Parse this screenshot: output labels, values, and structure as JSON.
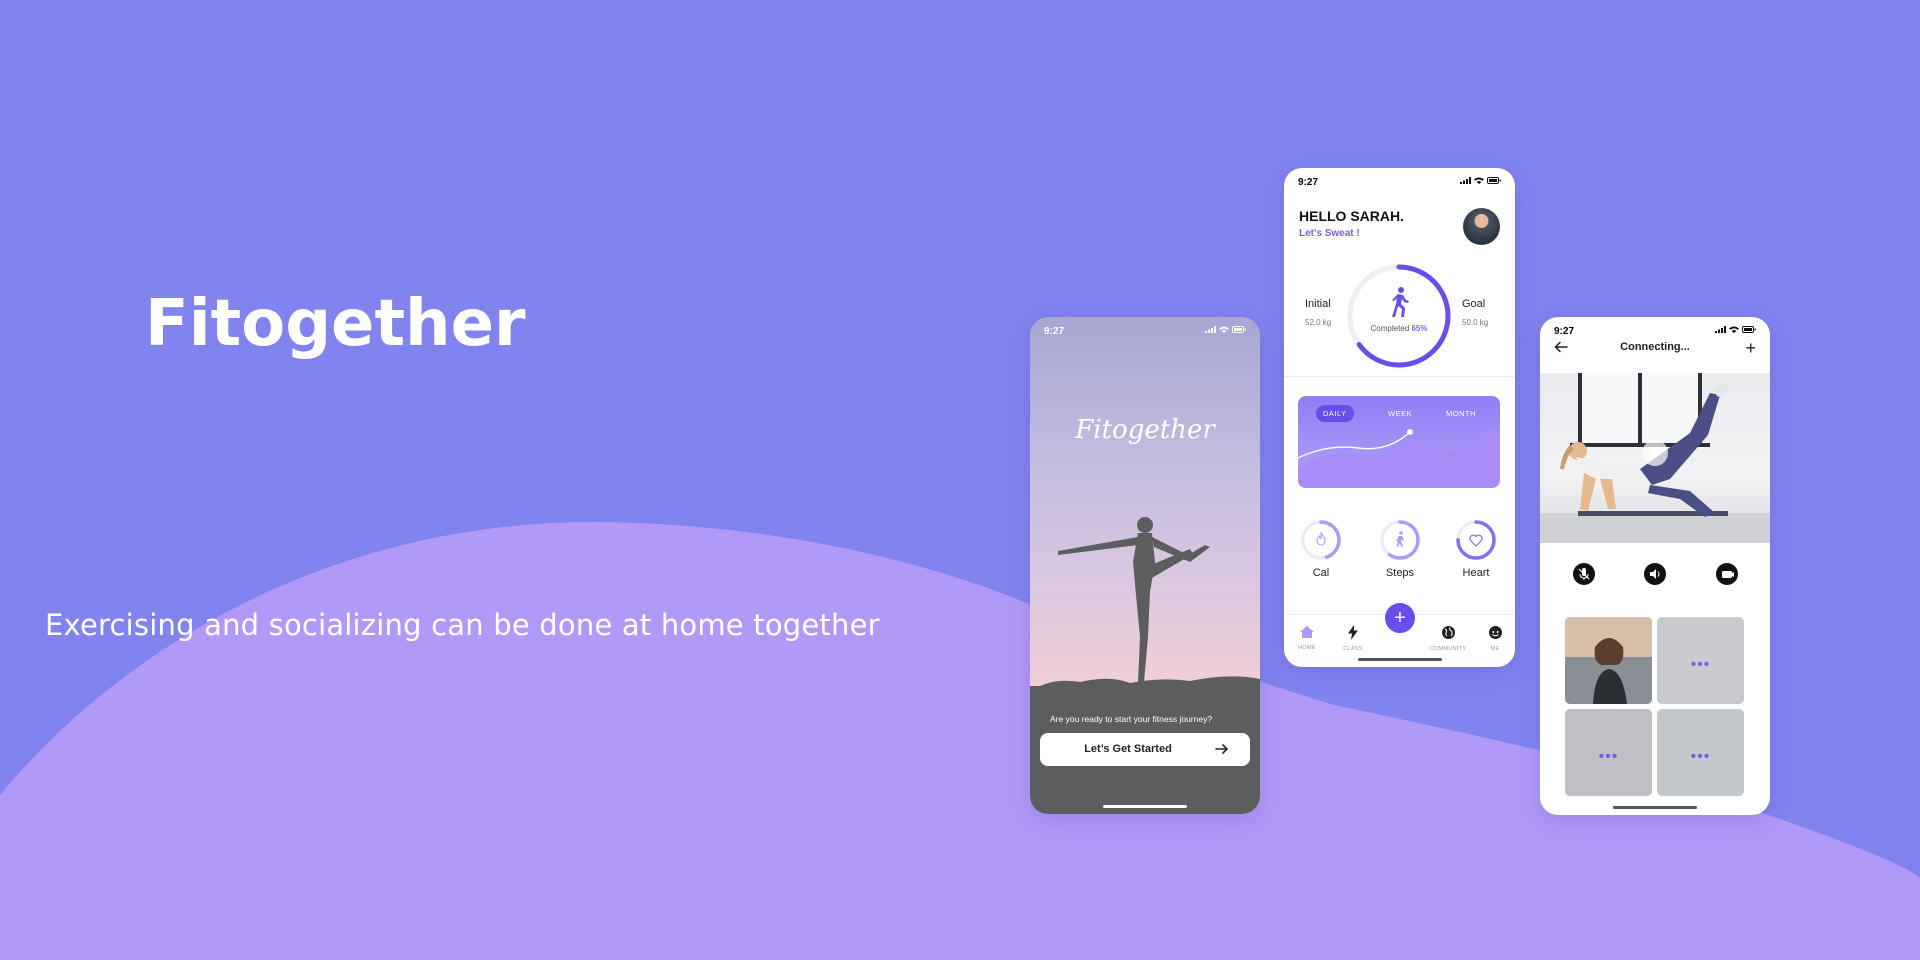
{
  "hero": {
    "title": "Fitogether",
    "subtitle": "Exercising and socializing can be done at home together"
  },
  "colors": {
    "background": "#8183ef",
    "wave": "#b199f7",
    "accent": "#6a4de8",
    "accent_light": "#7b5cf0"
  },
  "phone1": {
    "time": "9:27",
    "logo": "Fitogether",
    "question": "Are you ready to start your fitness journey?",
    "cta_label": "Let’s Get Started"
  },
  "phone2": {
    "time": "9:27",
    "greeting": "HELLO SARAH.",
    "tagline": "Let's Sweat !",
    "initial_label": "Initial",
    "initial_value": "52.0 kg",
    "goal_label": "Goal",
    "goal_value": "50.0 kg",
    "completed_label": "Completed",
    "completed_value": "65%",
    "completed_fraction": 0.65,
    "tabs": [
      "DAILY",
      "WEEK",
      "MONTH"
    ],
    "metrics": [
      {
        "label": "Cal",
        "icon": "flame-icon",
        "fraction": 0.45
      },
      {
        "label": "Steps",
        "icon": "walk-icon",
        "fraction": 0.6
      },
      {
        "label": "Heart",
        "icon": "heart-icon",
        "fraction": 0.75
      }
    ],
    "nav": [
      {
        "label": "HOME",
        "icon": "home-icon"
      },
      {
        "label": "CLASS",
        "icon": "bolt-icon"
      },
      {
        "label": "COMMUNITY",
        "icon": "globe-icon"
      },
      {
        "label": "ME",
        "icon": "face-icon"
      }
    ]
  },
  "phone3": {
    "time": "9:27",
    "title": "Connecting...",
    "participant_placeholder": "•••"
  }
}
